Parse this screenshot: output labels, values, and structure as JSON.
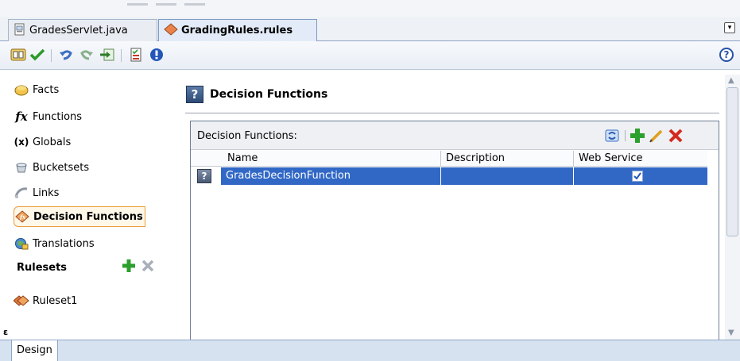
{
  "editor_tabs": [
    {
      "label": "GradesServlet.java",
      "icon": "java-file-icon"
    },
    {
      "label": "GradingRules.rules",
      "icon": "rules-file-icon"
    }
  ],
  "sidebar": {
    "items": [
      {
        "label": "Facts",
        "icon": "facts-icon"
      },
      {
        "label": "Functions",
        "icon": "function-icon"
      },
      {
        "label": "Globals",
        "icon": "globals-icon"
      },
      {
        "label": "Bucketsets",
        "icon": "bucketsets-icon"
      },
      {
        "label": "Links",
        "icon": "links-icon"
      },
      {
        "label": "Decision Functions",
        "icon": "decision-functions-icon"
      },
      {
        "label": "Translations",
        "icon": "translations-icon"
      }
    ],
    "functions_glyph": "fx",
    "globals_glyph": "(x)",
    "rulesets_header": "Rulesets",
    "rulesets": [
      {
        "label": "Ruleset1",
        "icon": "ruleset-icon"
      }
    ]
  },
  "main": {
    "title": "Decision Functions",
    "title_glyph": "?",
    "panel_label": "Decision Functions:",
    "columns": [
      "Name",
      "Description",
      "Web Service"
    ],
    "rows": [
      {
        "icon_glyph": "?",
        "name": "GradesDecisionFunction",
        "description": "",
        "web_service": true
      }
    ]
  },
  "bottom_tabs": [
    "Design"
  ],
  "colors": {
    "selection": "#3168c6",
    "accent": "#e8a040"
  }
}
